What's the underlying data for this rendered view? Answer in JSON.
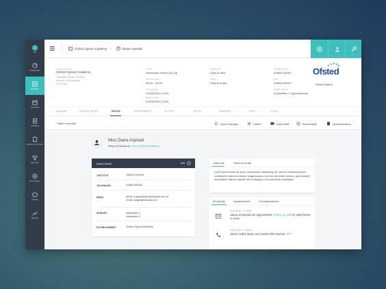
{
  "sidebar": {
    "logo_text": "laat",
    "items": [
      {
        "label": "Dashboard",
        "icon": "dashboard-icon"
      },
      {
        "label": "Directory",
        "icon": "directory-icon",
        "active": true
      },
      {
        "label": "Calendar",
        "icon": "calendar-icon"
      },
      {
        "label": "Activities",
        "icon": "activities-icon"
      },
      {
        "label": "Quotes & Invoices",
        "icon": "quotes-icon"
      },
      {
        "label": "My Lists",
        "icon": "lists-icon"
      },
      {
        "label": "Promotions",
        "icon": "promotions-icon"
      },
      {
        "label": "Orders",
        "icon": "orders-icon"
      },
      {
        "label": "Reports",
        "icon": "reports-icon"
      }
    ]
  },
  "breadcrumb": {
    "academy": "Oxford Spires Academy",
    "separator": "/",
    "person": "Diane Aspinall"
  },
  "info": {
    "association_label": "Association",
    "association_name": "Oxford Spires Academy",
    "address": [
      "Glanville Road, Cowley",
      "Oxford, Oxfordshire",
      "OX4 2AU"
    ],
    "type_label": "Type",
    "type_value": "Secondary School (11-18)",
    "school_day_label": "School Day",
    "school_day_value": "08:45 - 15:15",
    "last_visit_label": "Last Visit",
    "last_visit_value": "01/03/2016 | 16:00",
    "next_visit_label": "Next Visit",
    "next_visit_value": "01/03/2016 | 16:00",
    "website_label": "Website",
    "website_value": "Click to view",
    "email_label": "Email",
    "email_value": "Click to email",
    "telephone_label": "Telephone",
    "telephone_value": "01865 428200",
    "fax_label": "Fax",
    "fax_value": "01865 428201",
    "open_tasks_label": "Open Tasks",
    "open_tasks_value": "6 Activities / 2 Appointments",
    "ofsted_logo": "Ofsted",
    "ofsted_caption": "Ofsted Data"
  },
  "tabs": [
    "Summary",
    "Sales by month",
    "People",
    "Appointments",
    "Activity",
    "Notes",
    "Ordering",
    "Visits",
    "A Data"
  ],
  "actions": {
    "back": "Back to people",
    "sync": "Sync Changes",
    "delete": "Delete",
    "add_email": "Add Email",
    "add_activity": "Add Activity",
    "questionnaires": "Questionnaires"
  },
  "profile": {
    "name": "Miss Diane Aspinall",
    "role_prefix": "Head of Drama at",
    "role_link": "Oxford Spires Academy"
  },
  "about": {
    "title": "About Diane",
    "edit": "Edit",
    "rows": [
      {
        "key": "Job Title",
        "value": [
          "Head of Drama"
        ]
      },
      {
        "key": "Telephone",
        "value": [
          "01685 683294"
        ]
      },
      {
        "key": "Email",
        "value": [
          "Work: d.aspinall@oxsacharch.sch.uk",
          "Home: daspi@hotmail.com"
        ]
      },
      {
        "key": "Signups",
        "value": [
          "Newsletter 1",
          "Newsletter 2"
        ]
      },
      {
        "key": "Establishment",
        "value": [
          "Oxford Spires Academy"
        ]
      }
    ]
  },
  "note": {
    "tab_add_note": "Add note",
    "tab_send_email": "Send an email",
    "text": "Lorem ipsum dolor sit amet, consectetur adipisicing elit, sed do eiusmod tempor incididunt ut labore et dolore magna aliqua. Ut enim ad minim veniam, quis nostrud exercitation ullamco laboris nisi ut aliquip ex ea commodo consequat."
  },
  "activity": {
    "tabs": [
      "All Activity",
      "Appointments",
      "Correspondence"
    ],
    "events": [
      {
        "icon": "calendar-icon",
        "date": "16/07/2015 · 17:09PM",
        "text_prefix": "Jason scheduled an appointment:",
        "link": "Follow up call",
        "text_suffix": "for 16/07/2015",
        "sub": "11:15AM"
      },
      {
        "icon": "phone-icon",
        "date": "16/07/2015 · 17:09PM",
        "text_prefix": "Jason called Diane and marked the lead as",
        "link": "HOT",
        "text_suffix": "",
        "sub": ""
      }
    ]
  },
  "colors": {
    "accent": "#3ebfbe",
    "sidebar": "#323c4a",
    "text": "#3d4a57",
    "brand_ofsted": "#1e4f9c"
  }
}
